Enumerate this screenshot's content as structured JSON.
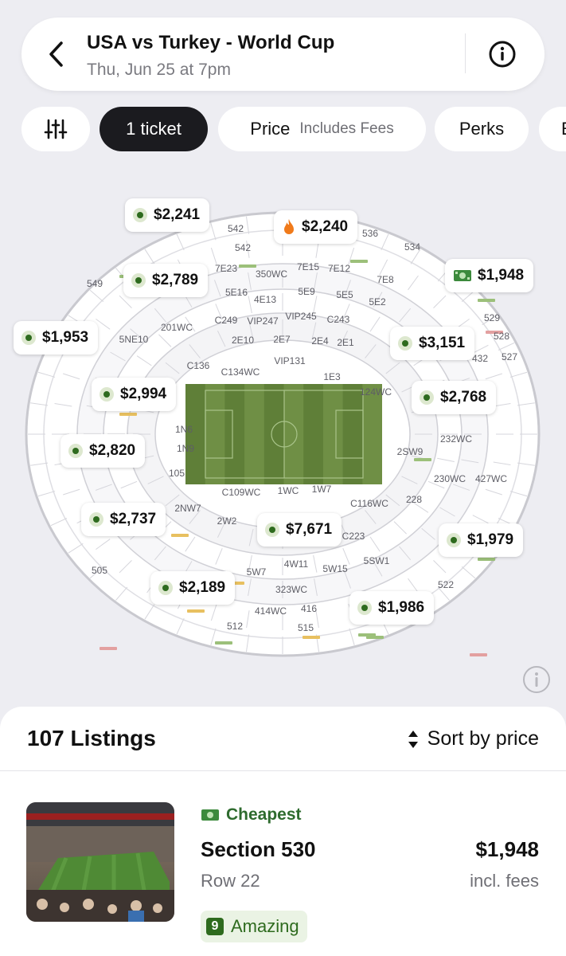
{
  "header": {
    "title": "USA vs Turkey - World Cup",
    "subtitle": "Thu, Jun 25 at 7pm",
    "back_icon": "chevron-left-icon",
    "info_icon": "info-icon"
  },
  "filters": {
    "filter_icon": "sliders-icon",
    "tickets": "1 ticket",
    "price": "Price",
    "price_note": "Includes Fees",
    "perks": "Perks",
    "cut_off_chip": "E"
  },
  "map": {
    "section_labels": [
      "542",
      "536",
      "534",
      "549",
      "542",
      "7E23",
      "350WC",
      "7E15",
      "7E12",
      "7E8",
      "5E16",
      "4E13",
      "5E9",
      "5E5",
      "5E2",
      "529",
      "528",
      "527",
      "432",
      "5NE10",
      "201WC",
      "C249",
      "VIP247",
      "VIP245",
      "C243",
      "2E10",
      "2E7",
      "2E4",
      "2E1",
      "C136",
      "VIP131",
      "C134WC",
      "1E3",
      "124WC",
      "1N6",
      "1N9",
      "105",
      "2SW9",
      "232WC",
      "427WC",
      "230WC",
      "228",
      "C109WC",
      "1WC",
      "1W7",
      "C116WC",
      "2NW7",
      "2W2",
      "C223",
      "5SW1",
      "4W11",
      "5W7",
      "5W15",
      "505",
      "323WC",
      "522",
      "414WC",
      "416",
      "512",
      "515"
    ],
    "price_pins": [
      {
        "label": "$2,241",
        "icon": "dot"
      },
      {
        "label": "$2,240",
        "icon": "fire-icon"
      },
      {
        "label": "$1,948",
        "icon": "cash-icon"
      },
      {
        "label": "$2,789",
        "icon": "dot"
      },
      {
        "label": "$1,953",
        "icon": "dot"
      },
      {
        "label": "$3,151",
        "icon": "dot"
      },
      {
        "label": "$2,994",
        "icon": "dot"
      },
      {
        "label": "$2,768",
        "icon": "dot"
      },
      {
        "label": "$2,820",
        "icon": "dot"
      },
      {
        "label": "$2,737",
        "icon": "dot"
      },
      {
        "label": "$7,671",
        "icon": "dot"
      },
      {
        "label": "$1,979",
        "icon": "dot"
      },
      {
        "label": "$2,189",
        "icon": "dot"
      },
      {
        "label": "$1,986",
        "icon": "dot"
      }
    ],
    "colors": {
      "field": "#6f8f45",
      "field_stripe": "#5f7f38",
      "pin_dot": "#2e6b1e",
      "fire": "#f07a1a"
    }
  },
  "listings": {
    "count_label": "107 Listings",
    "sort_label": "Sort by price",
    "items": [
      {
        "tag": "Cheapest",
        "section": "Section 530",
        "row": "Row 22",
        "price": "$1,948",
        "fees": "incl. fees",
        "rating_score": "9",
        "rating_label": "Amazing"
      }
    ]
  }
}
